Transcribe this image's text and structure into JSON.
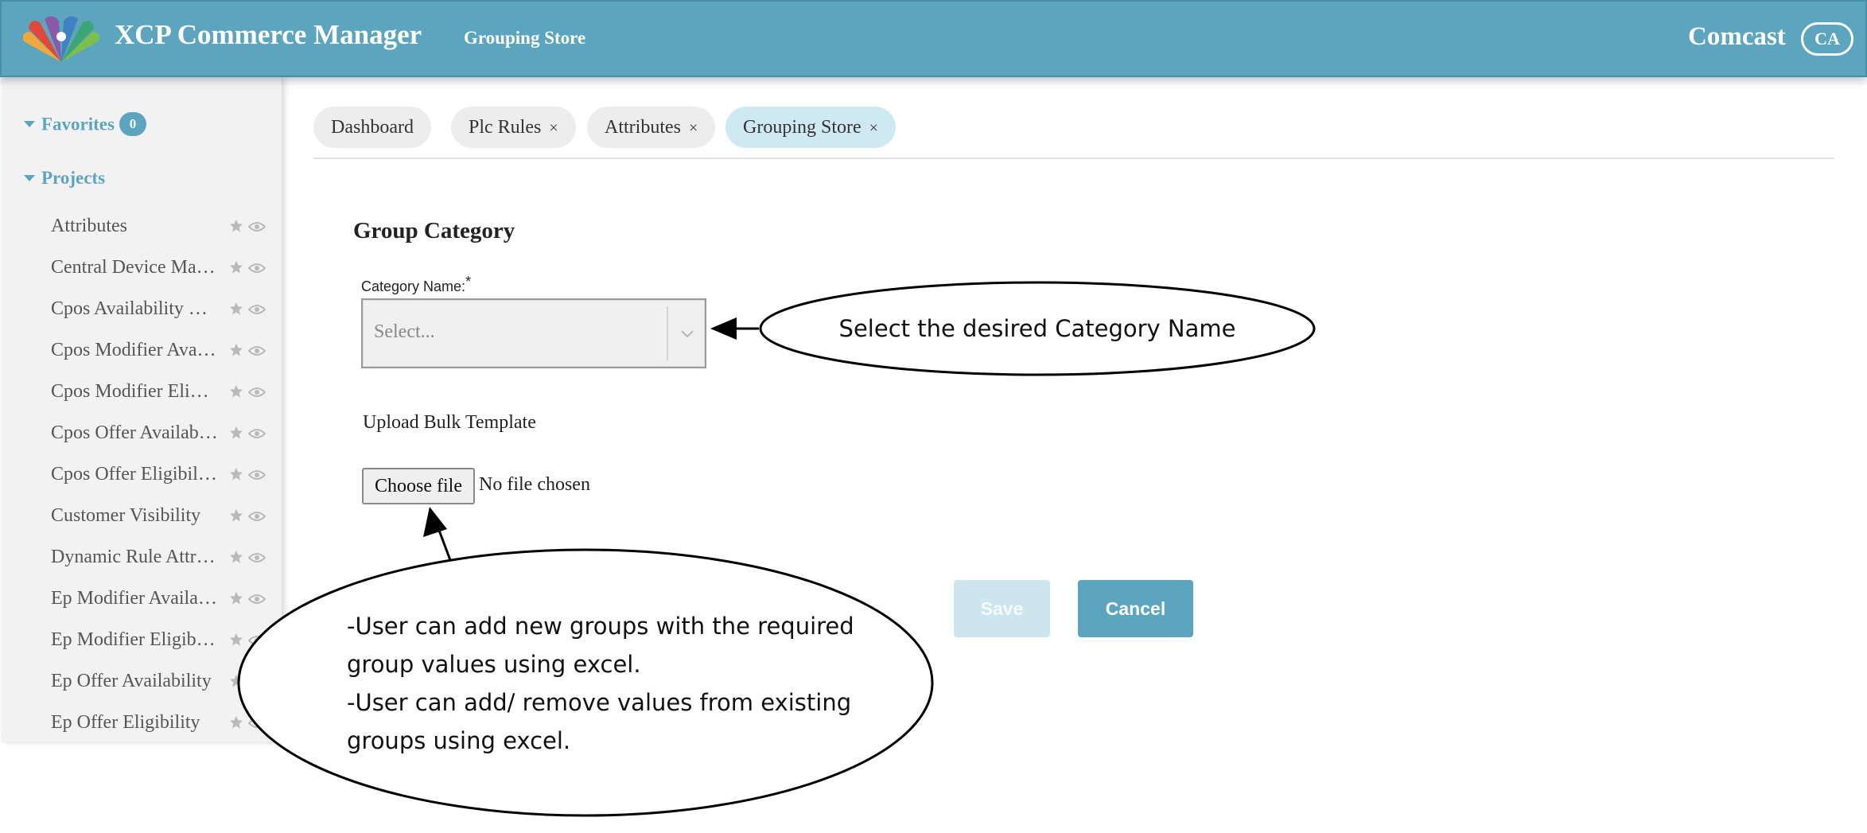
{
  "header": {
    "app_title": "XCP Commerce Manager",
    "current_page": "Grouping Store",
    "brand": "Comcast",
    "user_initials": "CA",
    "logo_icon": "peacock-logo",
    "background_color": "#5ba5be"
  },
  "sidebar": {
    "favorites_label": "Favorites",
    "favorites_count": "0",
    "projects_label": "Projects",
    "items": [
      {
        "label": "Attributes"
      },
      {
        "label": "Central Device Management"
      },
      {
        "label": "Cpos Availability Rules"
      },
      {
        "label": "Cpos Modifier Availability"
      },
      {
        "label": "Cpos Modifier Eligibility"
      },
      {
        "label": "Cpos Offer Availability"
      },
      {
        "label": "Cpos Offer Eligibility"
      },
      {
        "label": "Customer Visibility"
      },
      {
        "label": "Dynamic Rule Attributes"
      },
      {
        "label": "Ep Modifier Availability"
      },
      {
        "label": "Ep Modifier Eligibility"
      },
      {
        "label": "Ep Offer Availability"
      },
      {
        "label": "Ep Offer Eligibility"
      }
    ]
  },
  "tabs": [
    {
      "label": "Dashboard",
      "closable": false
    },
    {
      "label": "Plc Rules",
      "closable": true
    },
    {
      "label": "Attributes",
      "closable": true
    },
    {
      "label": "Grouping Store",
      "closable": true,
      "active": true
    }
  ],
  "tab_close_glyph": "×",
  "form": {
    "title": "Group Category",
    "category_label": "Category Name:",
    "required_marker": "*",
    "category_placeholder": "Select...",
    "upload_label": "Upload Bulk Template",
    "choose_file_label": "Choose file",
    "file_status": "No file chosen",
    "save_label": "Save",
    "cancel_label": "Cancel"
  },
  "annotations": {
    "category_note": "Select the desired Category Name",
    "upload_note_lines": [
      "-User can add new groups with the required",
      "group values using excel.",
      "-User can add/ remove values from existing",
      "groups using excel."
    ]
  }
}
